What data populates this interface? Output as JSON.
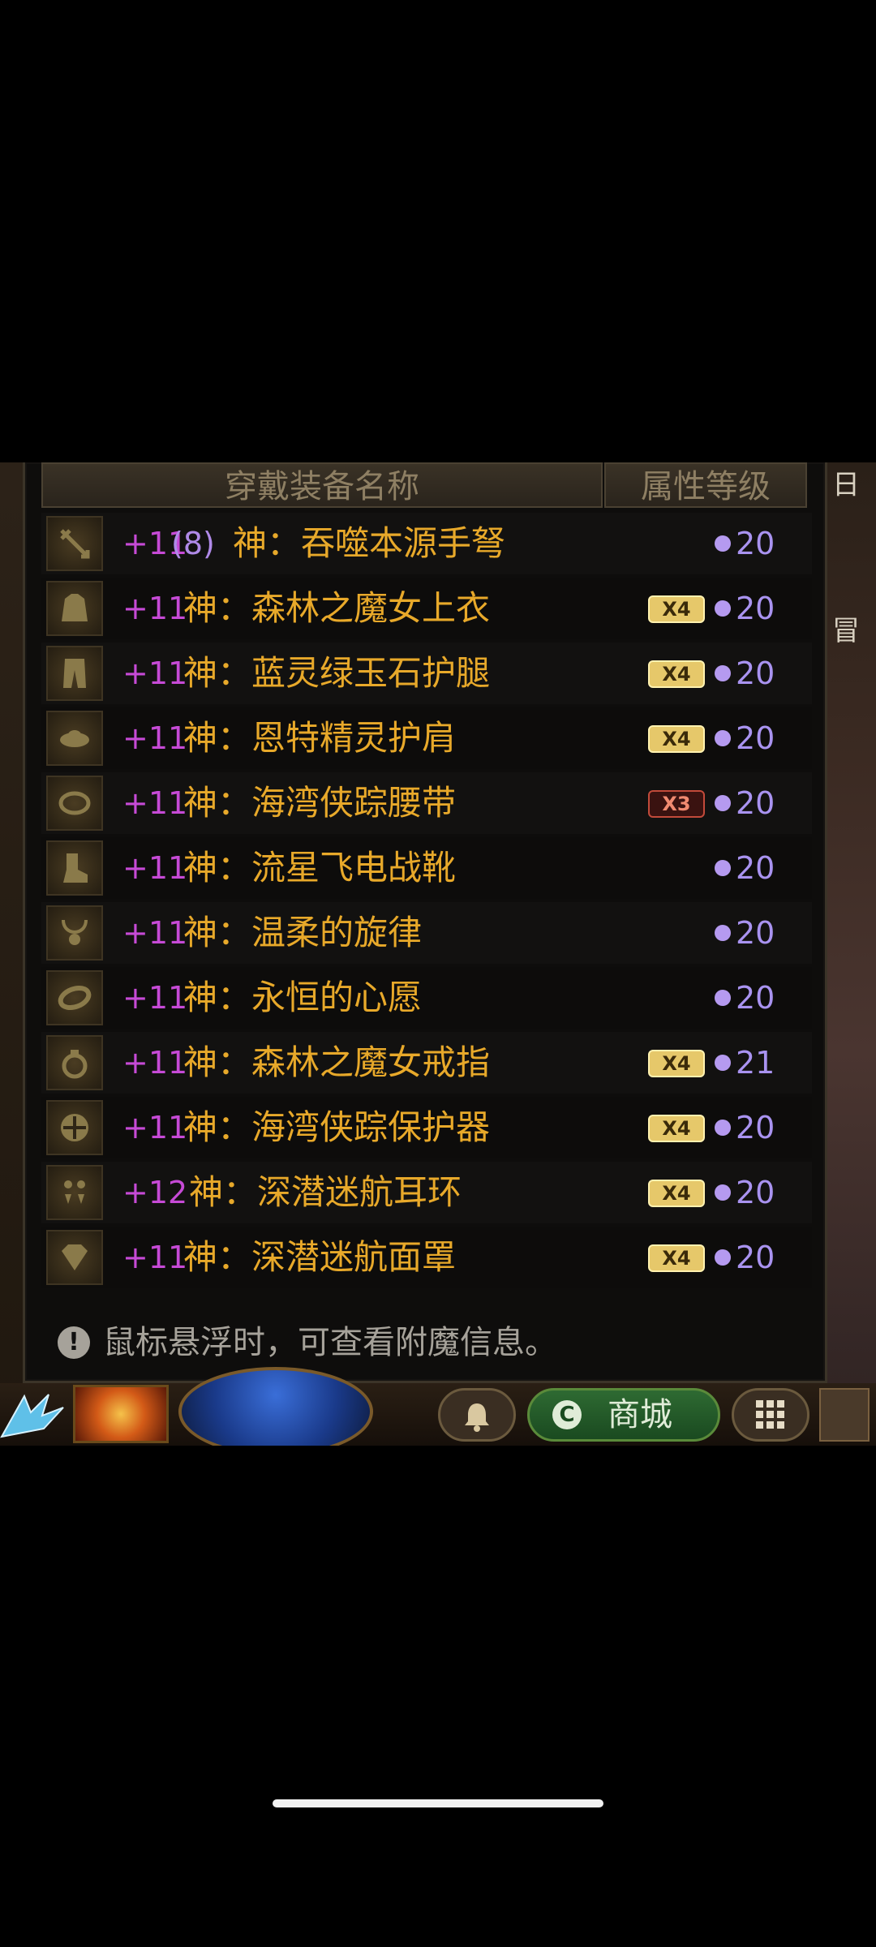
{
  "header": {
    "name_col": "穿戴装备名称",
    "level_col": "属性等级"
  },
  "side": {
    "right_top": "日",
    "right_mid": "冒"
  },
  "items": [
    {
      "slot_icon": "crossbow-icon",
      "plus": "+11",
      "extra": "(8)",
      "name": "神：吞噬本源手弩",
      "enchant": "",
      "enchant_style": "",
      "level": "20"
    },
    {
      "slot_icon": "coat-icon",
      "plus": "+11",
      "extra": "",
      "name": "神：森林之魔女上衣",
      "enchant": "X4",
      "enchant_style": "gold",
      "level": "20"
    },
    {
      "slot_icon": "pants-icon",
      "plus": "+11",
      "extra": "",
      "name": "神：蓝灵绿玉石护腿",
      "enchant": "X4",
      "enchant_style": "gold",
      "level": "20"
    },
    {
      "slot_icon": "shoulder-icon",
      "plus": "+11",
      "extra": "",
      "name": "神：恩特精灵护肩",
      "enchant": "X4",
      "enchant_style": "gold",
      "level": "20"
    },
    {
      "slot_icon": "belt-icon",
      "plus": "+11",
      "extra": "",
      "name": "神：海湾侠踪腰带",
      "enchant": "X3",
      "enchant_style": "red",
      "level": "20"
    },
    {
      "slot_icon": "boots-icon",
      "plus": "+11",
      "extra": "",
      "name": "神：流星飞电战靴",
      "enchant": "",
      "enchant_style": "",
      "level": "20"
    },
    {
      "slot_icon": "necklace-icon",
      "plus": "+11",
      "extra": "",
      "name": "神：温柔的旋律",
      "enchant": "",
      "enchant_style": "",
      "level": "20"
    },
    {
      "slot_icon": "bracelet-icon",
      "plus": "+11",
      "extra": "",
      "name": "神：永恒的心愿",
      "enchant": "",
      "enchant_style": "",
      "level": "20"
    },
    {
      "slot_icon": "ring-icon",
      "plus": "+11",
      "extra": "",
      "name": "神：森林之魔女戒指",
      "enchant": "X4",
      "enchant_style": "gold",
      "level": "21"
    },
    {
      "slot_icon": "subweapon-icon",
      "plus": "+11",
      "extra": "",
      "name": "神：海湾侠踪保护器",
      "enchant": "X4",
      "enchant_style": "gold",
      "level": "20"
    },
    {
      "slot_icon": "earring-icon",
      "plus": "+12",
      "extra": "",
      "name": "神：深潜迷航耳环",
      "enchant": "X4",
      "enchant_style": "gold",
      "level": "20"
    },
    {
      "slot_icon": "gem-icon",
      "plus": "+11",
      "extra": "",
      "name": "神：深潜迷航面罩",
      "enchant": "X4",
      "enchant_style": "gold",
      "level": "20"
    }
  ],
  "tip": {
    "icon": "!",
    "text": "鼠标悬浮时，可查看附魔信息。"
  },
  "bottombar": {
    "shop_icon": "C",
    "shop_label": "商城"
  },
  "colors": {
    "item_name": "#e8a92a",
    "plus": "#c64ad6",
    "level": "#a993f0",
    "header_text": "#8e7f63"
  }
}
